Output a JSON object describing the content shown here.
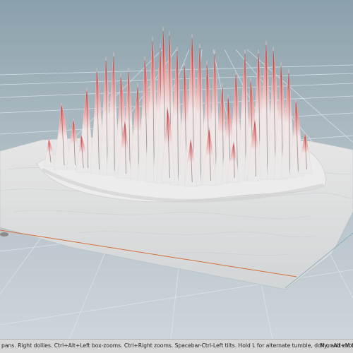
{
  "viewport": {
    "name": "3D scene viewport",
    "background_top": "#8fa3ae",
    "background_bottom": "#c7d0d5",
    "grid_color": "#cfe2ec",
    "peak_color": "#e8383b",
    "terrain_color": "#e6e6e6",
    "axis_color": "#d4703a"
  },
  "status_bar": {
    "hint_text": "dle pans. Right dollies. Ctrl+Alt+Left box-zooms. Ctrl+Right zooms. Spacebar-Ctrl-Left tilts. Hold L for alternate tumble, dolly, and zoom.",
    "hint_text_right": "M or Alt+M for"
  }
}
